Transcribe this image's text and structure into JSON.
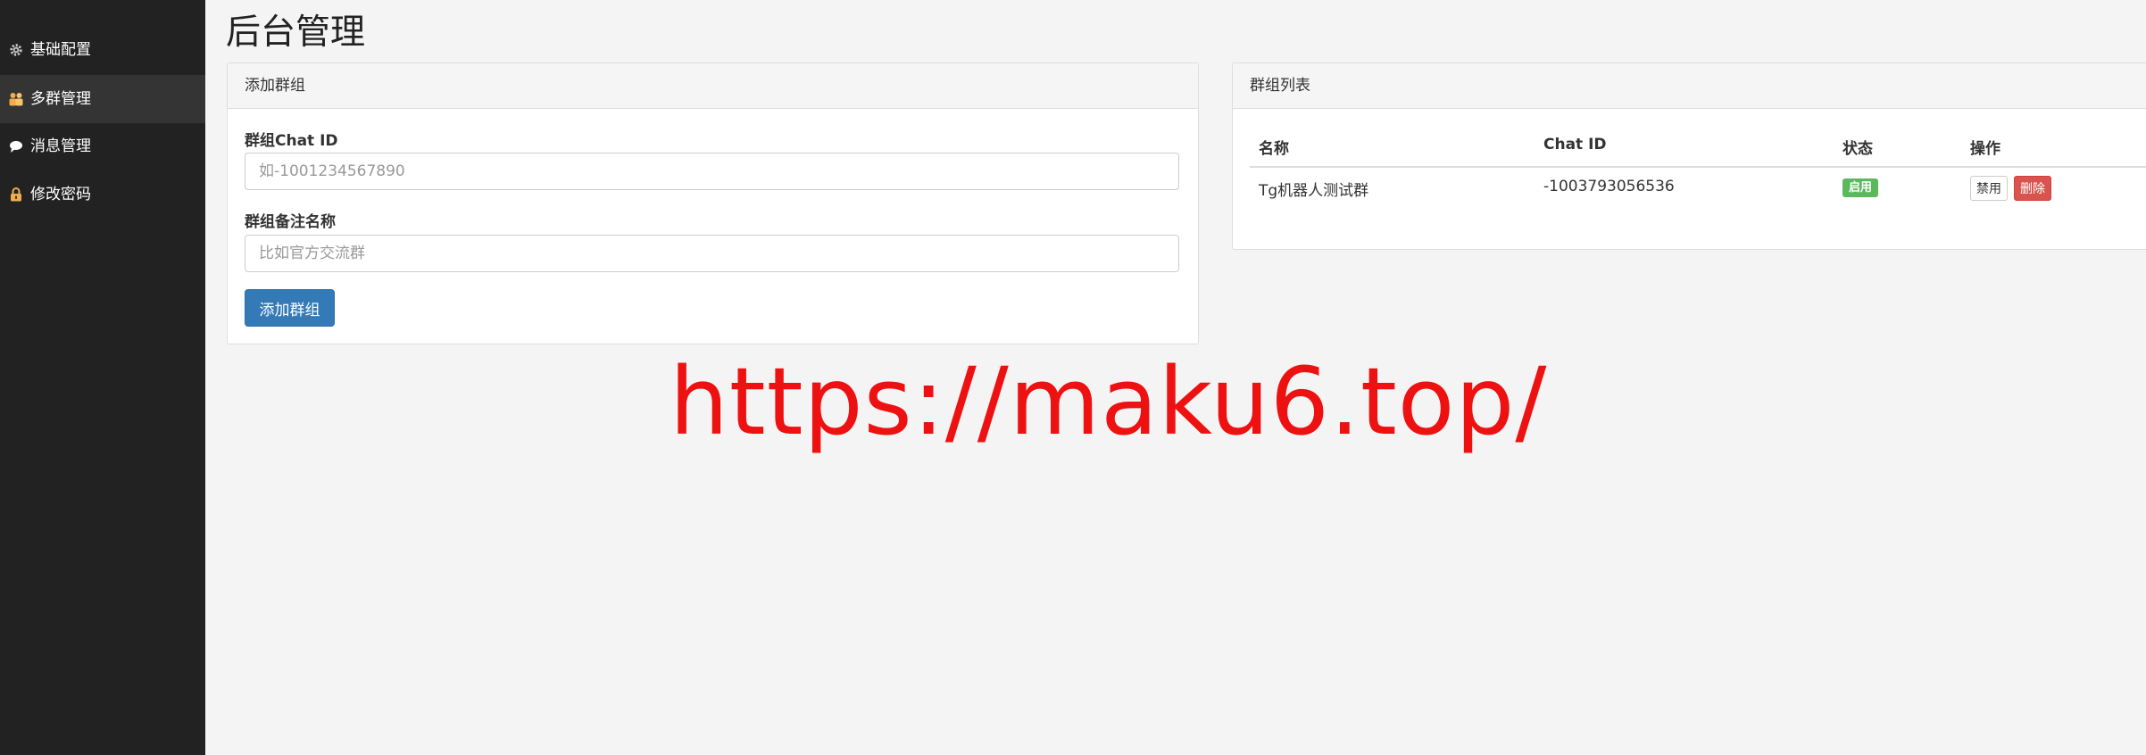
{
  "sidebar": {
    "items": [
      {
        "label": "基础配置",
        "icon": "gear-icon"
      },
      {
        "label": "多群管理",
        "icon": "users-icon"
      },
      {
        "label": "消息管理",
        "icon": "comment-icon"
      },
      {
        "label": "修改密码",
        "icon": "lock-icon"
      }
    ],
    "active_index": 1
  },
  "page": {
    "title": "后台管理"
  },
  "add_group": {
    "heading": "添加群组",
    "chat_id_label": "群组Chat ID",
    "chat_id_placeholder": "如-1001234567890",
    "name_label": "群组备注名称",
    "name_placeholder": "比如官方交流群",
    "submit_label": "添加群组"
  },
  "group_list": {
    "heading": "群组列表",
    "columns": [
      "名称",
      "Chat ID",
      "状态",
      "操作"
    ],
    "rows": [
      {
        "name": "Tg机器人测试群",
        "chat_id": "-1003793056536",
        "status": "启用",
        "actions": [
          "禁用",
          "删除"
        ]
      }
    ]
  },
  "watermark": {
    "text": "https://maku6.top/"
  },
  "colors": {
    "sidebar_bg": "#222222",
    "primary": "#337ab7",
    "success": "#5cb85c",
    "danger": "#d9534f",
    "watermark": "#ee1111"
  }
}
